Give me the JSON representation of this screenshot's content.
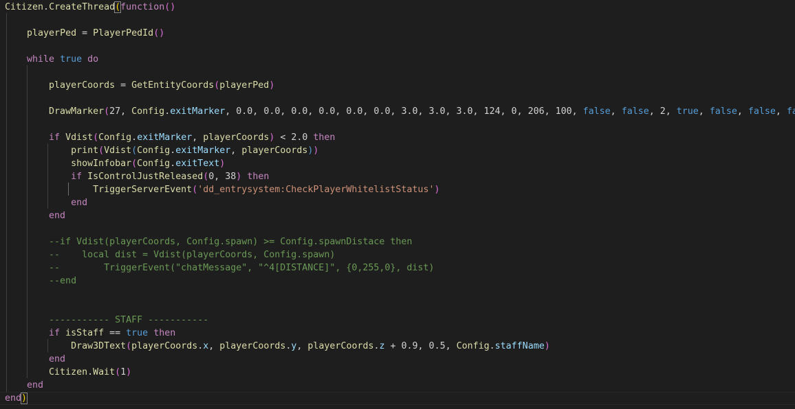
{
  "editor": {
    "theme_colors": {
      "background": "#1e1e1e",
      "function": "#dcdcaa",
      "keyword": "#c586c0",
      "boolean": "#569cd6",
      "number": "#b5cea8",
      "string": "#ce9178",
      "comment": "#6a9955"
    },
    "lines": [
      [
        [
          "g",
          "Citizen"
        ],
        [
          "p",
          "."
        ],
        [
          "g",
          "CreateThread"
        ],
        [
          "by",
          "("
        ],
        [
          "k",
          "function"
        ],
        [
          "bp",
          "()"
        ]
      ],
      [],
      [
        [
          "p",
          "    "
        ],
        [
          "g",
          "playerPed"
        ],
        [
          "p",
          " = "
        ],
        [
          "g",
          "PlayerPedId"
        ],
        [
          "bp",
          "()"
        ]
      ],
      [],
      [
        [
          "p",
          "    "
        ],
        [
          "k",
          "while"
        ],
        [
          "p",
          " "
        ],
        [
          "b",
          "true"
        ],
        [
          "p",
          " "
        ],
        [
          "k",
          "do"
        ]
      ],
      [],
      [
        [
          "p",
          "        "
        ],
        [
          "g",
          "playerCoords"
        ],
        [
          "p",
          " = "
        ],
        [
          "g",
          "GetEntityCoords"
        ],
        [
          "bp",
          "("
        ],
        [
          "g",
          "playerPed"
        ],
        [
          "bp",
          ")"
        ]
      ],
      [],
      [
        [
          "p",
          "        "
        ],
        [
          "g",
          "DrawMarker"
        ],
        [
          "bp",
          "("
        ],
        [
          "p",
          "27, "
        ],
        [
          "g",
          "Config"
        ],
        [
          "p",
          "."
        ],
        [
          "v",
          "exitMarker"
        ],
        [
          "p",
          ", 0.0, 0.0, 0.0, 0.0, 0.0, 0.0, 3.0, 3.0, 3.0, 124, 0, 206, 100, "
        ],
        [
          "b",
          "false"
        ],
        [
          "p",
          ", "
        ],
        [
          "b",
          "false"
        ],
        [
          "p",
          ", 2, "
        ],
        [
          "b",
          "true"
        ],
        [
          "p",
          ", "
        ],
        [
          "b",
          "false"
        ],
        [
          "p",
          ", "
        ],
        [
          "b",
          "false"
        ],
        [
          "p",
          ", "
        ],
        [
          "b",
          "false"
        ],
        [
          "bp",
          ")"
        ]
      ],
      [],
      [
        [
          "p",
          "        "
        ],
        [
          "k",
          "if"
        ],
        [
          "p",
          " "
        ],
        [
          "g",
          "Vdist"
        ],
        [
          "bp",
          "("
        ],
        [
          "g",
          "Config"
        ],
        [
          "p",
          "."
        ],
        [
          "v",
          "exitMarker"
        ],
        [
          "p",
          ", "
        ],
        [
          "g",
          "playerCoords"
        ],
        [
          "bp",
          ")"
        ],
        [
          "p",
          " < 2.0 "
        ],
        [
          "k",
          "then"
        ]
      ],
      [
        [
          "p",
          "            "
        ],
        [
          "g",
          "print"
        ],
        [
          "bp",
          "("
        ],
        [
          "g",
          "Vdist"
        ],
        [
          "b",
          "("
        ],
        [
          "g",
          "Config"
        ],
        [
          "p",
          "."
        ],
        [
          "v",
          "exitMarker"
        ],
        [
          "p",
          ", "
        ],
        [
          "g",
          "playerCoords"
        ],
        [
          "b",
          ")"
        ],
        [
          "bp",
          ")"
        ]
      ],
      [
        [
          "p",
          "            "
        ],
        [
          "g",
          "showInfobar"
        ],
        [
          "bp",
          "("
        ],
        [
          "g",
          "Config"
        ],
        [
          "p",
          "."
        ],
        [
          "v",
          "exitText"
        ],
        [
          "bp",
          ")"
        ]
      ],
      [
        [
          "p",
          "            "
        ],
        [
          "k",
          "if"
        ],
        [
          "p",
          " "
        ],
        [
          "g",
          "IsControlJustReleased"
        ],
        [
          "bp",
          "("
        ],
        [
          "p",
          "0, 38"
        ],
        [
          "bp",
          ")"
        ],
        [
          "p",
          " "
        ],
        [
          "k",
          "then"
        ]
      ],
      [
        [
          "p",
          "                "
        ],
        [
          "g",
          "TriggerServerEvent"
        ],
        [
          "bp",
          "("
        ],
        [
          "s",
          "'dd_entrysystem:CheckPlayerWhitelistStatus'"
        ],
        [
          "bp",
          ")"
        ]
      ],
      [
        [
          "p",
          "            "
        ],
        [
          "k",
          "end"
        ]
      ],
      [
        [
          "p",
          "        "
        ],
        [
          "k",
          "end"
        ]
      ],
      [],
      [
        [
          "c",
          "        --if Vdist(playerCoords, Config.spawn) >= Config.spawnDistace then"
        ]
      ],
      [
        [
          "c",
          "        --    local dist = Vdist(playerCoords, Config.spawn)"
        ]
      ],
      [
        [
          "c",
          "        --        TriggerEvent(\"chatMessage\", \"^4[DISTANCE]\", {0,255,0}, dist)"
        ]
      ],
      [
        [
          "c",
          "        --end"
        ]
      ],
      [],
      [],
      [
        [
          "c",
          "        ----------- STAFF -----------"
        ]
      ],
      [
        [
          "p",
          "        "
        ],
        [
          "k",
          "if"
        ],
        [
          "p",
          " "
        ],
        [
          "g",
          "isStaff"
        ],
        [
          "p",
          " == "
        ],
        [
          "b",
          "true"
        ],
        [
          "p",
          " "
        ],
        [
          "k",
          "then"
        ]
      ],
      [
        [
          "p",
          "            "
        ],
        [
          "g",
          "Draw3DText"
        ],
        [
          "bp",
          "("
        ],
        [
          "g",
          "playerCoords"
        ],
        [
          "p",
          "."
        ],
        [
          "v",
          "x"
        ],
        [
          "p",
          ", "
        ],
        [
          "g",
          "playerCoords"
        ],
        [
          "p",
          "."
        ],
        [
          "v",
          "y"
        ],
        [
          "p",
          ", "
        ],
        [
          "g",
          "playerCoords"
        ],
        [
          "p",
          "."
        ],
        [
          "v",
          "z"
        ],
        [
          "p",
          " + 0.9, 0.5, "
        ],
        [
          "g",
          "Config"
        ],
        [
          "p",
          "."
        ],
        [
          "v",
          "staffName"
        ],
        [
          "bp",
          ")"
        ]
      ],
      [
        [
          "p",
          "        "
        ],
        [
          "k",
          "end"
        ]
      ],
      [
        [
          "p",
          "        "
        ],
        [
          "g",
          "Citizen"
        ],
        [
          "p",
          "."
        ],
        [
          "g",
          "Wait"
        ],
        [
          "bp",
          "("
        ],
        [
          "p",
          "1"
        ],
        [
          "bp",
          ")"
        ]
      ],
      [
        [
          "p",
          "    "
        ],
        [
          "k",
          "end"
        ]
      ],
      [
        [
          "k",
          "end"
        ],
        [
          "by",
          ")"
        ]
      ]
    ]
  }
}
